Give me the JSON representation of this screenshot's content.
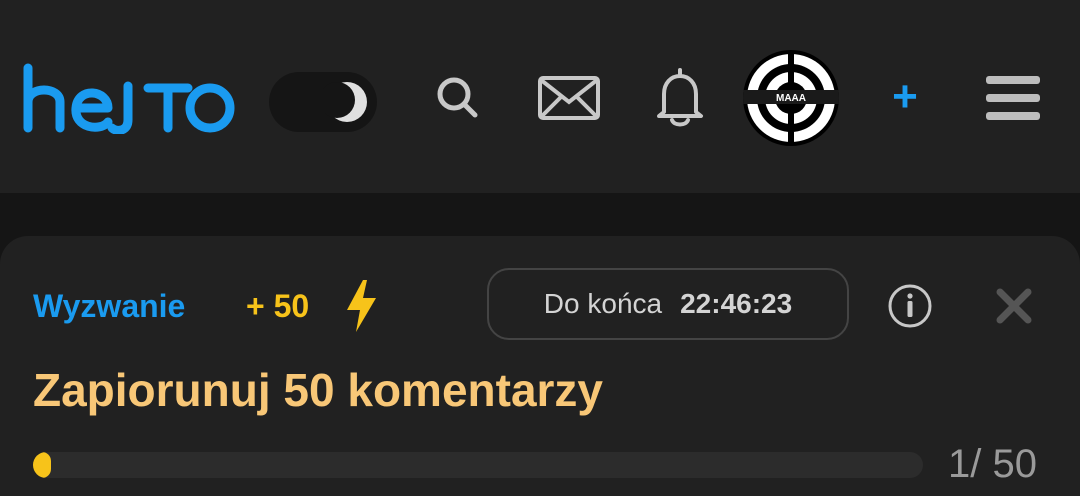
{
  "header": {
    "logo_text": "hejto",
    "theme_toggle": {
      "mode": "dark"
    },
    "avatar_label": "MAAA",
    "plus_label": "+"
  },
  "challenge": {
    "label": "Wyzwanie",
    "points": "+ 50",
    "timer_label": "Do końca",
    "timer_value": "22:46:23",
    "title": "Zapiorunuj 50 komentarzy",
    "progress_current": 1,
    "progress_total": 50,
    "progress_text": "1/ 50"
  },
  "colors": {
    "brand_blue": "#1a9bf0",
    "accent_yellow": "#f7c31a",
    "title_orange": "#f8c777",
    "background": "#151515",
    "surface": "#212121"
  },
  "icons": [
    "search-icon",
    "mail-icon",
    "bell-icon",
    "menu-icon",
    "info-icon",
    "close-icon",
    "lightning-icon",
    "moon-icon"
  ]
}
